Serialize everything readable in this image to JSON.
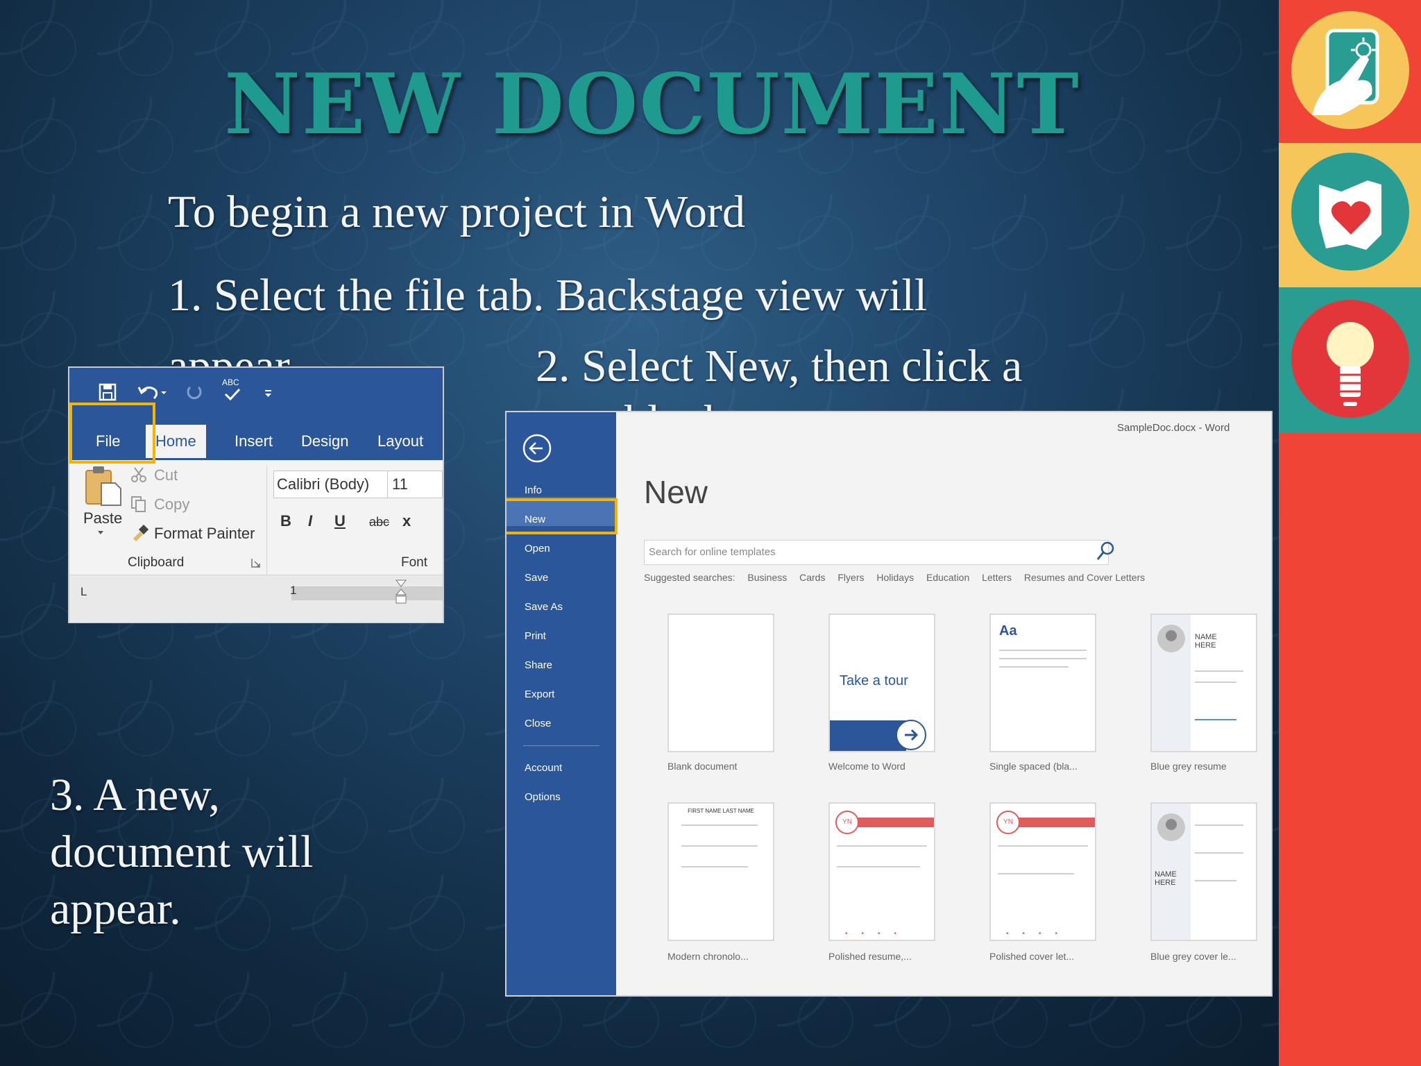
{
  "slide": {
    "title": "NEW DOCUMENT",
    "intro": "To begin a new project in Word",
    "step1_line1": "1.  Select the file tab. Backstage view will",
    "step1_line2": "appear.",
    "step2_line1": "2.  Select New, then click a",
    "step2_line2": "blank",
    "step3_line1": "3.  A new,",
    "step3_line2": "document will",
    "step3_line3": "appear."
  },
  "ribbon": {
    "tabs": [
      "File",
      "Home",
      "Insert",
      "Design",
      "Layout"
    ],
    "paste_label": "Paste",
    "cut_label": "Cut",
    "copy_label": "Copy",
    "format_painter_label": "Format Painter",
    "clipboard_group": "Clipboard",
    "font_name": "Calibri (Body)",
    "font_size": "11",
    "font_group": "Font",
    "bold": "B",
    "italic": "I",
    "underline": "U",
    "strike": "abc",
    "subscript": "x",
    "ruler_num": "1",
    "tab_stop": "L",
    "spell_label": "ABC"
  },
  "backstage": {
    "window_title": "SampleDoc.docx - Word",
    "heading": "New",
    "search_placeholder": "Search for online templates",
    "menu": [
      "Info",
      "New",
      "Open",
      "Save",
      "Save As",
      "Print",
      "Share",
      "Export",
      "Close",
      "Account",
      "Options"
    ],
    "suggested": [
      "Suggested searches:",
      "Business",
      "Cards",
      "Flyers",
      "Holidays",
      "Education",
      "Letters",
      "Resumes and Cover Letters"
    ],
    "templates": [
      {
        "caption": "Blank document"
      },
      {
        "caption": "Welcome to Word",
        "text": "Take a tour"
      },
      {
        "caption": "Single spaced (bla...",
        "text": "Aa"
      },
      {
        "caption": "Blue grey resume",
        "text": "NAME HERE"
      },
      {
        "caption": "Modern chronolo...",
        "text": "FIRST NAME LAST NAME"
      },
      {
        "caption": "Polished resume,...",
        "text": "YN"
      },
      {
        "caption": "Polished cover let...",
        "text": "YN"
      },
      {
        "caption": "Blue grey cover le...",
        "text": "NAME HERE"
      }
    ]
  },
  "side_icons": [
    "tablet-touch-icon",
    "ohio-heart-icon",
    "lightbulb-icon"
  ],
  "colors": {
    "title": "#1f9a8e",
    "word_blue": "#2b579a",
    "highlight": "#f5b400",
    "side_red": "#ef4436",
    "side_yellow": "#f7c65a",
    "side_teal": "#2a9d92"
  }
}
